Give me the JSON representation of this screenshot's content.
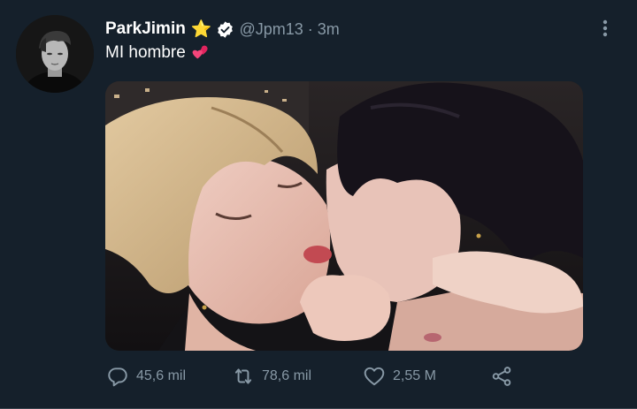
{
  "tweet": {
    "display_name": "ParkJimin",
    "name_emoji": "⭐",
    "handle_time": "@Jpm13 · 3m",
    "text": "MI hombre",
    "text_emoji": "two-hearts",
    "avatar": "profile-photo",
    "media": "photo"
  },
  "actions": {
    "reply": {
      "icon": "reply-icon",
      "count": "45,6 mil"
    },
    "retweet": {
      "icon": "retweet-icon",
      "count": "78,6 mil"
    },
    "like": {
      "icon": "heart-icon",
      "count": "2,55 M"
    },
    "share": {
      "icon": "share-icon"
    }
  },
  "colors": {
    "background": "#15202b",
    "secondary_text": "#8899a6",
    "primary_text": "#ffffff",
    "star": "#ffcc33",
    "heart_emoji": "#e0245e"
  }
}
